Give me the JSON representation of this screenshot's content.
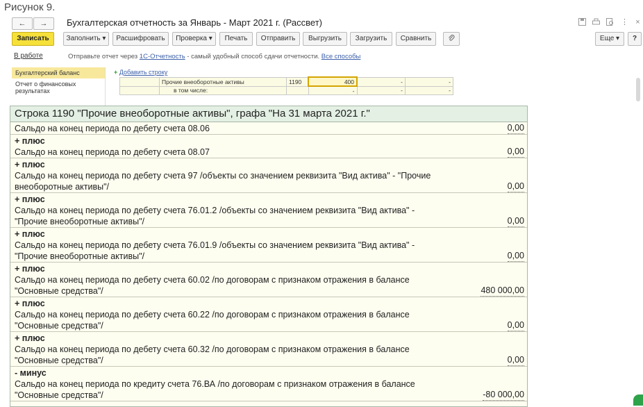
{
  "caption": "Рисунок 9.",
  "window": {
    "title": "Бухгалтерская отчетность за Январь - Март 2021 г. (Рассвет)",
    "back_label": "←",
    "forward_label": "→",
    "more_label": "⋮",
    "close_label": "×"
  },
  "toolbar": {
    "save": "Записать",
    "fill": "Заполнить ▾",
    "decode": "Расшифровать",
    "check": "Проверка ▾",
    "print": "Печать",
    "send": "Отправить",
    "upload": "Выгрузить",
    "load": "Загрузить",
    "compare": "Сравнить",
    "more": "Еще ▾",
    "help": "?"
  },
  "infobar": {
    "status": "В работе",
    "text_before": "Отправьте отчет через ",
    "link1": "1С-Отчетность",
    "text_middle": " - самый удобный способ сдачи отчетности. ",
    "link2": "Все способы"
  },
  "sidebar": {
    "items": [
      {
        "label": "Бухгалтерский баланс"
      },
      {
        "label": "Отчет о финансовых результатах"
      }
    ]
  },
  "grid": {
    "add_row": "Добавить строку",
    "row1": {
      "name": "Прочие внеоборотные активы",
      "code": "1190",
      "v1": "400",
      "v2": "-",
      "v3": "-"
    },
    "row2": {
      "name": "в том числе:",
      "v1": "-",
      "v2": "-",
      "v3": "-"
    }
  },
  "popup": {
    "title": "Строка 1190 \"Прочие внеоборотные активы\", графа \"На 31 марта 2021 г.\"",
    "blocks": [
      {
        "op": "",
        "text": "Сальдо на конец периода по дебету счета 08.06",
        "value": "0,00"
      },
      {
        "op": "+ плюс",
        "text": "Сальдо на конец периода по дебету счета 08.07",
        "value": "0,00"
      },
      {
        "op": "+ плюс",
        "text": "Сальдо на конец периода по дебету счета 97 /объекты со значением реквизита \"Вид актива\" - \"Прочие внеоборотные активы\"/",
        "value": "0,00"
      },
      {
        "op": "+ плюс",
        "text": "Сальдо на конец периода по дебету счета 76.01.2 /объекты со значением реквизита \"Вид актива\" - \"Прочие внеоборотные активы\"/",
        "value": "0,00"
      },
      {
        "op": "+ плюс",
        "text": "Сальдо на конец периода по дебету счета 76.01.9 /объекты со значением реквизита \"Вид актива\" - \"Прочие внеоборотные активы\"/",
        "value": "0,00"
      },
      {
        "op": "+ плюс",
        "text": "Сальдо на конец периода по дебету счета 60.02 /по договорам с признаком отражения в балансе \"Основные средства\"/",
        "value": "480 000,00"
      },
      {
        "op": "+ плюс",
        "text": "Сальдо на конец периода по дебету счета 60.22 /по договорам с признаком отражения в балансе \"Основные средства\"/",
        "value": "0,00"
      },
      {
        "op": "+ плюс",
        "text": "Сальдо на конец периода по дебету счета 60.32 /по договорам с признаком отражения в балансе \"Основные средства\"/",
        "value": "0,00"
      },
      {
        "op": "- минус",
        "text": "Сальдо на конец периода по кредиту счета 76.ВА /по договорам с признаком отражения в балансе \"Основные средства\"/",
        "value": "-80 000,00"
      }
    ]
  }
}
